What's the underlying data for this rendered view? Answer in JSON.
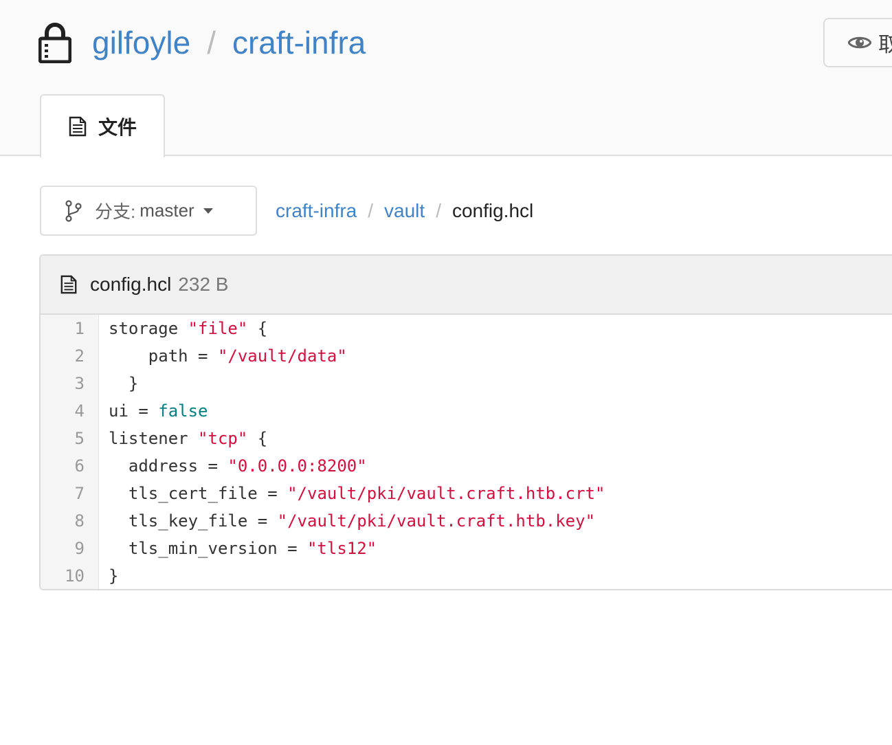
{
  "header": {
    "owner": "gilfoyle",
    "separator": "/",
    "repo": "craft-infra",
    "watch_label": "取"
  },
  "tabs": [
    {
      "label": "文件",
      "icon": "file-text-icon"
    }
  ],
  "branch": {
    "prefix": "分支:",
    "name": "master"
  },
  "breadcrumb": {
    "parts": [
      "craft-infra",
      "vault"
    ],
    "current": "config.hcl",
    "separator": "/"
  },
  "file": {
    "name": "config.hcl",
    "size": "232 B"
  },
  "code": {
    "line_numbers": [
      "1",
      "2",
      "3",
      "4",
      "5",
      "6",
      "7",
      "8",
      "9",
      "10"
    ],
    "lines": [
      [
        {
          "t": "storage "
        },
        {
          "t": "\"file\"",
          "k": "str"
        },
        {
          "t": " {"
        }
      ],
      [
        {
          "t": "    path = "
        },
        {
          "t": "\"/vault/data\"",
          "k": "str"
        }
      ],
      [
        {
          "t": "  }"
        }
      ],
      [
        {
          "t": "ui = "
        },
        {
          "t": "false",
          "k": "kw"
        }
      ],
      [
        {
          "t": "listener "
        },
        {
          "t": "\"tcp\"",
          "k": "str"
        },
        {
          "t": " {"
        }
      ],
      [
        {
          "t": "  address = "
        },
        {
          "t": "\"0.0.0.0:8200\"",
          "k": "str"
        }
      ],
      [
        {
          "t": "  tls_cert_file = "
        },
        {
          "t": "\"/vault/pki/vault.craft.htb.crt\"",
          "k": "str"
        }
      ],
      [
        {
          "t": "  tls_key_file = "
        },
        {
          "t": "\"/vault/pki/vault.craft.htb.key\"",
          "k": "str"
        }
      ],
      [
        {
          "t": "  tls_min_version = "
        },
        {
          "t": "\"tls12\"",
          "k": "str"
        }
      ],
      [
        {
          "t": "}"
        }
      ]
    ]
  },
  "colors": {
    "link": "#4183c4",
    "string": "#d01040",
    "keyword": "#008080"
  }
}
